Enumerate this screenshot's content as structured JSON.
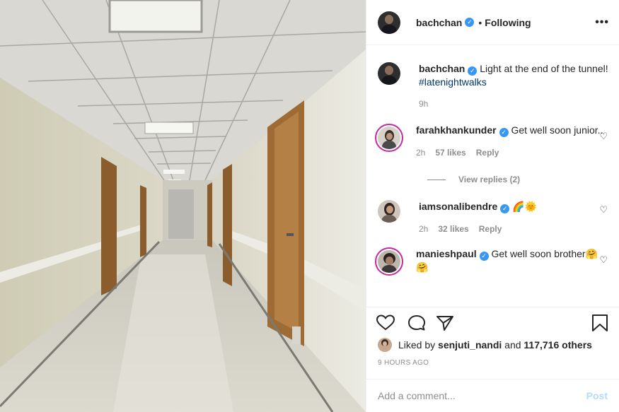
{
  "post": {
    "photo_alt": "Hospital corridor"
  },
  "header": {
    "username": "bachchan",
    "separator": "•",
    "follow_status": "Following",
    "more_label": "•••"
  },
  "caption": {
    "username": "bachchan",
    "text": "Light at the end of the tunnel!",
    "hashtag": "#latenightwalks",
    "age": "9h"
  },
  "comments": [
    {
      "username": "farahkhankunder",
      "text": "Get well soon junior..",
      "age": "2h",
      "likes": "57 likes",
      "reply_label": "Reply",
      "view_replies": "View replies (2)"
    },
    {
      "username": "iamsonalibendre",
      "text": "🌈🌞",
      "age": "2h",
      "likes": "32 likes",
      "reply_label": "Reply"
    },
    {
      "username": "manieshpaul",
      "text": "Get well soon brother🤗🤗"
    }
  ],
  "likes_line": {
    "prefix": "Liked by",
    "user": "senjuti_nandi",
    "conj": "and",
    "count": "117,716 others"
  },
  "timestamp": "9 HOURS AGO",
  "add_comment": {
    "placeholder": "Add a comment...",
    "post_label": "Post"
  },
  "colors": {
    "verified": "#3897f0",
    "story_ring": "#c32aa3",
    "link": "#003569",
    "muted": "#8e8e8e",
    "post_disabled": "#b3dbff"
  }
}
